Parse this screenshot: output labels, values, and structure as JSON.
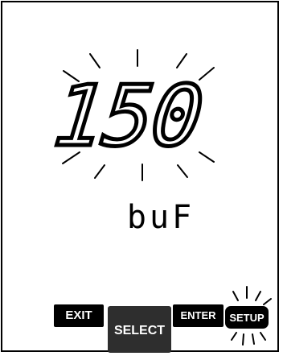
{
  "display": {
    "value": "150",
    "value_blinking": true,
    "unit": "buF"
  },
  "buttons": {
    "exit": "EXIT",
    "select": "SELECT",
    "enter": "ENTER",
    "setup": "SETUP",
    "setup_blinking": true
  },
  "icons": {
    "value_blink_indicator": "blink-rays-icon",
    "setup_blink_indicator": "blink-rays-icon"
  }
}
